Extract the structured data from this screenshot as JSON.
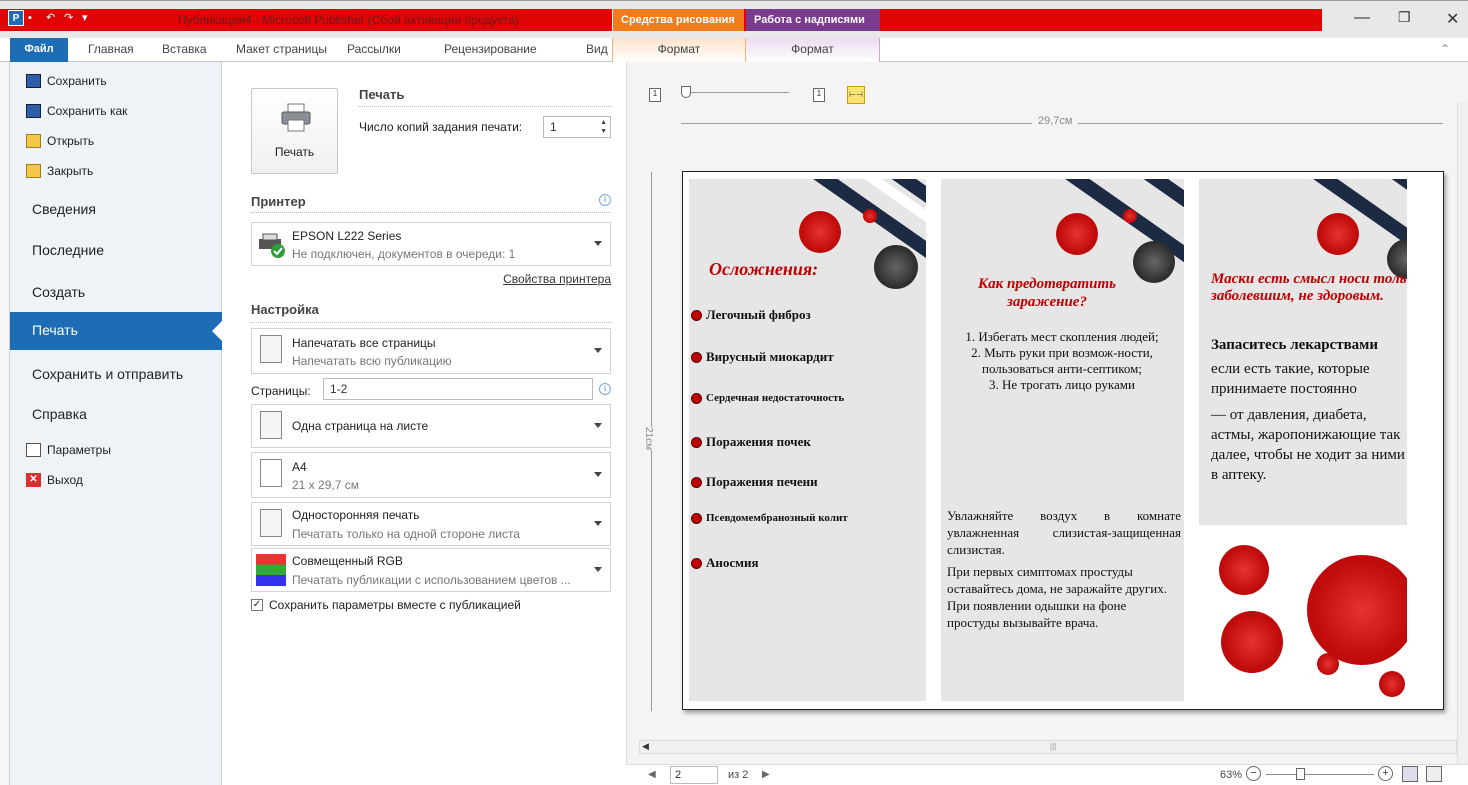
{
  "window": {
    "title": "Публикация4 - Microsoft Publisher (Сбой активации продукта)",
    "context_tab_drawing": "Средства рисования",
    "context_tab_text": "Работа с надписями",
    "colors": {
      "title_bar": "#e00404",
      "accent": "#1c6db5",
      "drawing_tools": "#f07c1c",
      "text_tools": "#7a3a8e",
      "virus_red": "#c30d0d"
    }
  },
  "ribbon": {
    "tabs": [
      "Файл",
      "Главная",
      "Вставка",
      "Макет страницы",
      "Рассылки",
      "Рецензирование",
      "Вид",
      "Формат",
      "Формат"
    ]
  },
  "backstage": {
    "commands": [
      {
        "label": "Сохранить",
        "icon": "save-icon"
      },
      {
        "label": "Сохранить как",
        "icon": "save-as-icon"
      },
      {
        "label": "Открыть",
        "icon": "open-folder-icon"
      },
      {
        "label": "Закрыть",
        "icon": "close-folder-icon"
      }
    ],
    "sections": [
      "Сведения",
      "Последние",
      "Создать",
      "Печать",
      "Сохранить и отправить",
      "Справка"
    ],
    "selected": "Печать",
    "bottom": [
      {
        "label": "Параметры",
        "icon": "options-icon"
      },
      {
        "label": "Выход",
        "icon": "exit-icon"
      }
    ]
  },
  "print": {
    "print_button": "Печать",
    "heading": "Печать",
    "copies_label": "Число копий задания печати:",
    "copies_value": "1",
    "printer_heading": "Принтер",
    "printer_name": "EPSON L222 Series",
    "printer_status": "Не подключен, документов в очереди: 1",
    "printer_props": "Свойства принтера",
    "settings_heading": "Настройка",
    "range_main": "Напечатать все страницы",
    "range_sub": "Напечатать всю публикацию",
    "pages_label": "Страницы:",
    "pages_value": "1-2",
    "layout": "Одна страница на листе",
    "paper_main": "A4",
    "paper_sub": "21 x 29,7 см",
    "sides_main": "Односторонняя печать",
    "sides_sub": "Печатать только на одной стороне листа",
    "color_main": "Совмещенный RGB",
    "color_sub": "Печатать публикации с использованием цветов ...",
    "save_settings": "Сохранить параметры вместе с публикацией",
    "save_settings_checked": true
  },
  "preview": {
    "ruler_width": "29,7см",
    "ruler_height": "21см",
    "page_current": "2",
    "page_total": "из 2",
    "zoom": "63%",
    "panel1": {
      "title": "Осложнения:",
      "items": [
        "Легочный фиброз",
        "Вирусный миокардит",
        "Сердечная недостаточность",
        "Поражения почек",
        "Поражения печени",
        "Псевдомембранозный колит",
        "Аносмия"
      ]
    },
    "panel2": {
      "title": "Как предотвратить заражение?",
      "list": [
        "1. Избегать мест скопления людей;",
        "2. Мыть руки при возмож-ности, пользоваться анти-септиком;",
        "3. Не трогать лицо руками"
      ],
      "para1": "Увлажняйте воздух в комнате увлажненная слизистая-защищенная слизистая.",
      "para2": "При первых симптомах простуды оставайтесь дома, не заражайте других. При появлении одышки на фоне простуды вызывайте врача."
    },
    "panel3": {
      "title": "Маски есть смысл носи только заболевшим, не здоровым.",
      "heading": "Запаситесь лекарствами",
      "para1": "если есть такие, которые принимаете постоянно",
      "para2": "— от давления, диабета, астмы, жаропонижающие так далее, чтобы не ходит за ними в аптеку."
    }
  }
}
